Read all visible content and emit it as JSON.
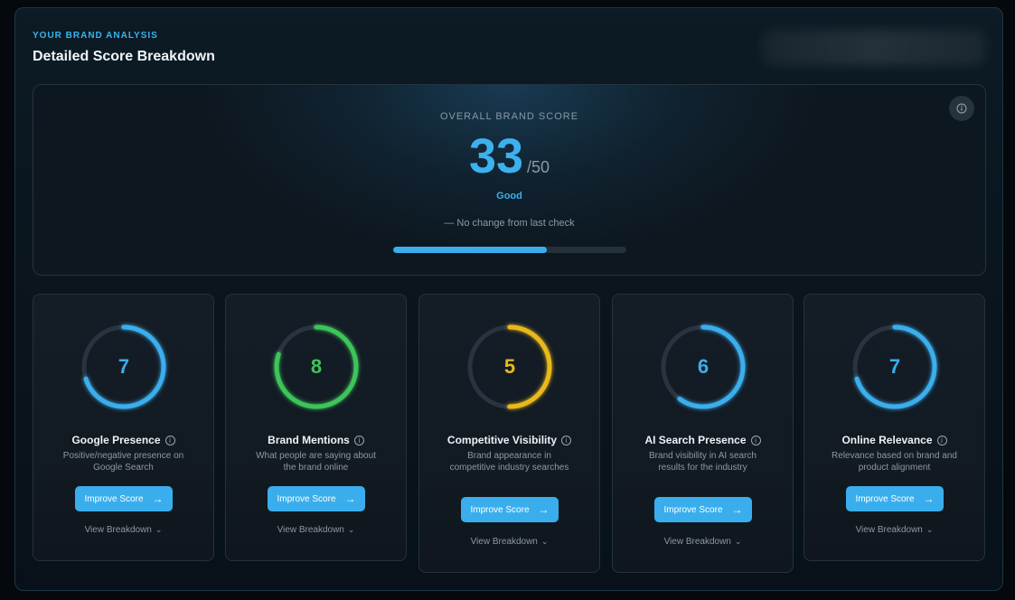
{
  "header": {
    "kicker": "YOUR BRAND ANALYSIS",
    "title": "Detailed Score Breakdown"
  },
  "overall": {
    "label": "OVERALL BRAND SCORE",
    "score": "33",
    "max": "/50",
    "rating": "Good",
    "change": "— No change from last check",
    "progress_fraction": 0.66,
    "info_icon": "info-icon"
  },
  "colors": {
    "blue": "#3aaeed",
    "green": "#3ec45a",
    "yellow": "#e9b91f",
    "track": "#2a3440"
  },
  "cards": [
    {
      "score": "7",
      "max": 10,
      "color": "#3aaeed",
      "title": "Google Presence",
      "description": "Positive/negative presence on Google Search",
      "button": "Improve Score",
      "link": "View Breakdown"
    },
    {
      "score": "8",
      "max": 10,
      "color": "#3ec45a",
      "title": "Brand Mentions",
      "description": "What people are saying about the brand online",
      "button": "Improve Score",
      "link": "View Breakdown"
    },
    {
      "score": "5",
      "max": 10,
      "color": "#e9b91f",
      "title": "Competitive Visibility",
      "description": "Brand appearance in competitive industry searches",
      "button": "Improve Score",
      "link": "View Breakdown"
    },
    {
      "score": "6",
      "max": 10,
      "color": "#3aaeed",
      "title": "AI Search Presence",
      "description": "Brand visibility in AI search results for the industry",
      "button": "Improve Score",
      "link": "View Breakdown"
    },
    {
      "score": "7",
      "max": 10,
      "color": "#3aaeed",
      "title": "Online Relevance",
      "description": "Relevance based on brand and product alignment",
      "button": "Improve Score",
      "link": "View Breakdown"
    }
  ]
}
